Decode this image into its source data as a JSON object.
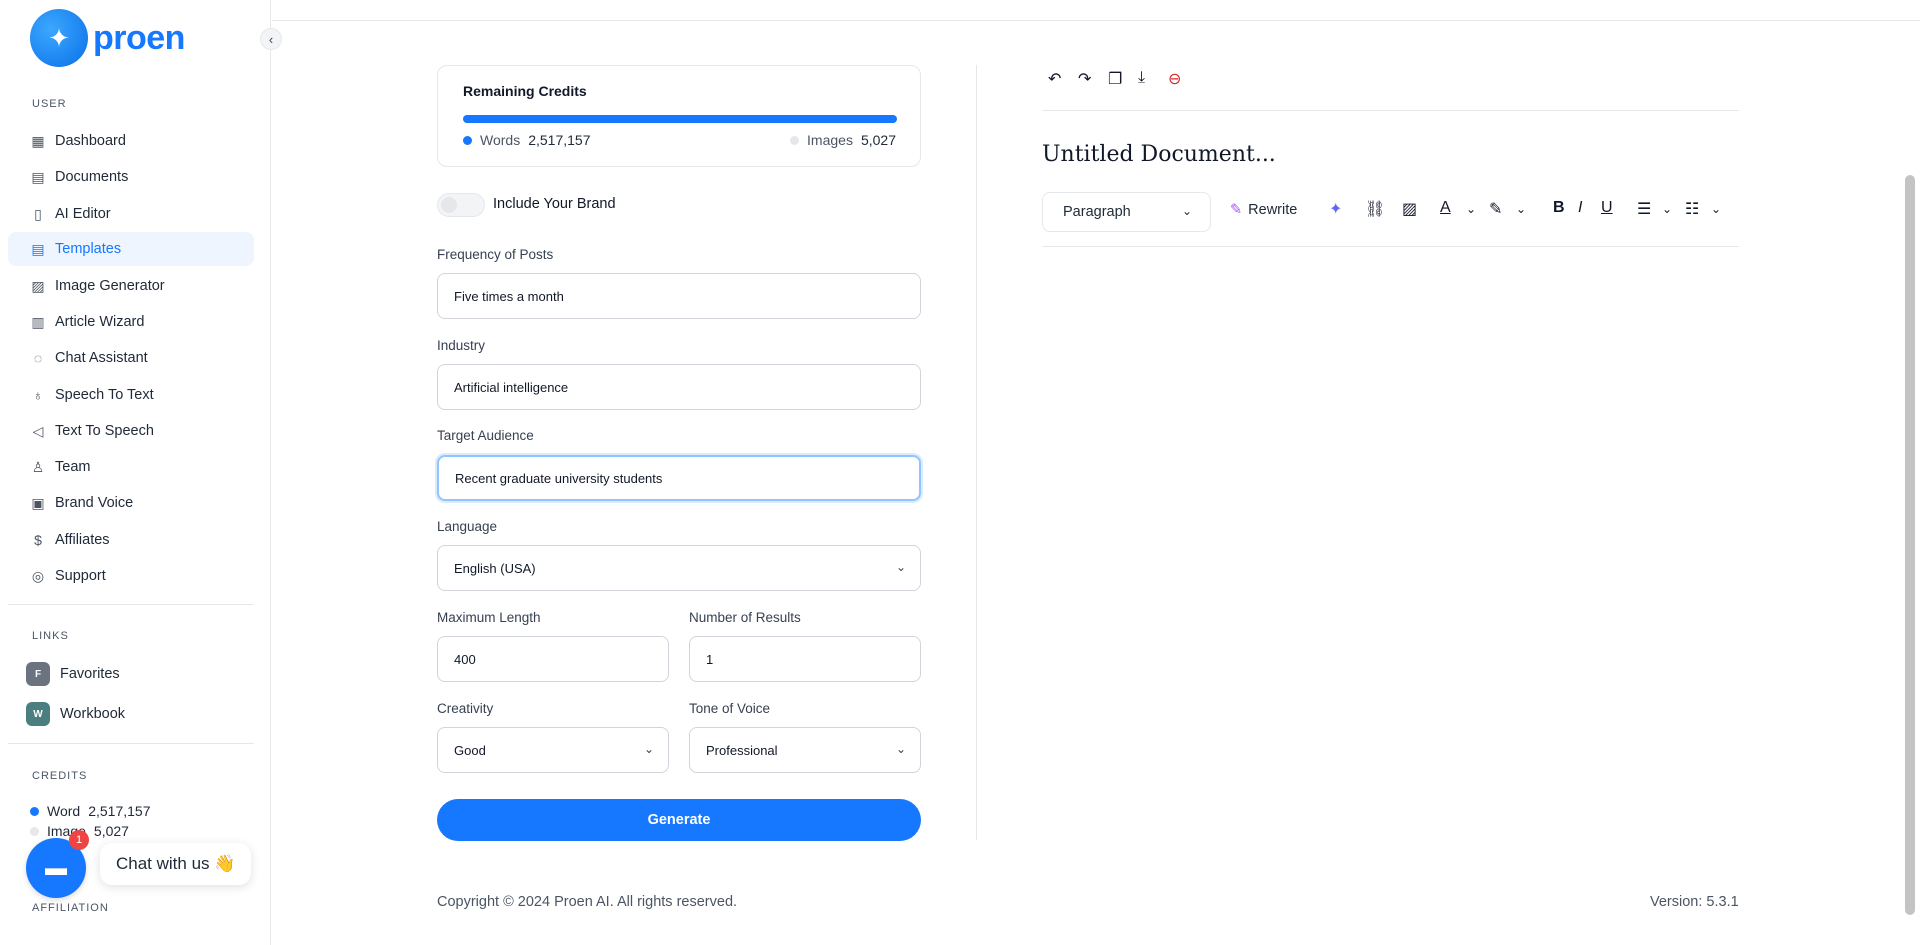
{
  "brand": {
    "name": "proen"
  },
  "sidebar": {
    "user_label": "USER",
    "items": [
      {
        "label": "Dashboard",
        "icon": "grid-icon"
      },
      {
        "label": "Documents",
        "icon": "archive-icon"
      },
      {
        "label": "AI Editor",
        "icon": "editor-icon"
      },
      {
        "label": "Templates",
        "icon": "templates-icon"
      },
      {
        "label": "Image Generator",
        "icon": "image-icon"
      },
      {
        "label": "Article Wizard",
        "icon": "article-icon"
      },
      {
        "label": "Chat Assistant",
        "icon": "chat-icon"
      },
      {
        "label": "Speech To Text",
        "icon": "mic-icon"
      },
      {
        "label": "Text To Speech",
        "icon": "speaker-icon"
      },
      {
        "label": "Team",
        "icon": "user-plus-icon"
      },
      {
        "label": "Brand Voice",
        "icon": "brand-icon"
      },
      {
        "label": "Affiliates",
        "icon": "dollar-icon"
      },
      {
        "label": "Support",
        "icon": "lifebuoy-icon"
      }
    ],
    "active_item": "Templates",
    "links_label": "LINKS",
    "links": [
      {
        "badge": "F",
        "label": "Favorites",
        "color": "#6b7280"
      },
      {
        "badge": "W",
        "label": "Workbook",
        "color": "#4b7f7f"
      }
    ],
    "credits_label": "CREDITS",
    "credits": [
      {
        "label": "Word",
        "value": "2,517,157"
      },
      {
        "label": "Image",
        "value": "5,027"
      }
    ],
    "affiliation_label": "AFFILIATION"
  },
  "chat": {
    "label": "Chat with us 👋",
    "badge": "1"
  },
  "credits_card": {
    "title": "Remaining Credits",
    "words_label": "Words",
    "words_value": "2,517,157",
    "images_label": "Images",
    "images_value": "5,027"
  },
  "form": {
    "brand_toggle_label": "Include Your Brand",
    "frequency_label": "Frequency of Posts",
    "frequency_value": "Five times a month",
    "industry_label": "Industry",
    "industry_value": "Artificial intelligence",
    "audience_label": "Target Audience",
    "audience_value": "Recent graduate university students",
    "language_label": "Language",
    "language_value": "English (USA)",
    "max_length_label": "Maximum Length",
    "max_length_value": "400",
    "results_label": "Number of Results",
    "results_value": "1",
    "creativity_label": "Creativity",
    "creativity_value": "Good",
    "tone_label": "Tone of Voice",
    "tone_value": "Professional",
    "generate_label": "Generate"
  },
  "editor": {
    "doc_title": "Untitled Document...",
    "paragraph_label": "Paragraph",
    "rewrite_label": "Rewrite"
  },
  "footer": {
    "copyright": "Copyright © 2024 Proen AI. All rights reserved.",
    "version": "Version: 5.3.1"
  },
  "colors": {
    "accent": "#1677ff",
    "danger": "#dc2626"
  }
}
